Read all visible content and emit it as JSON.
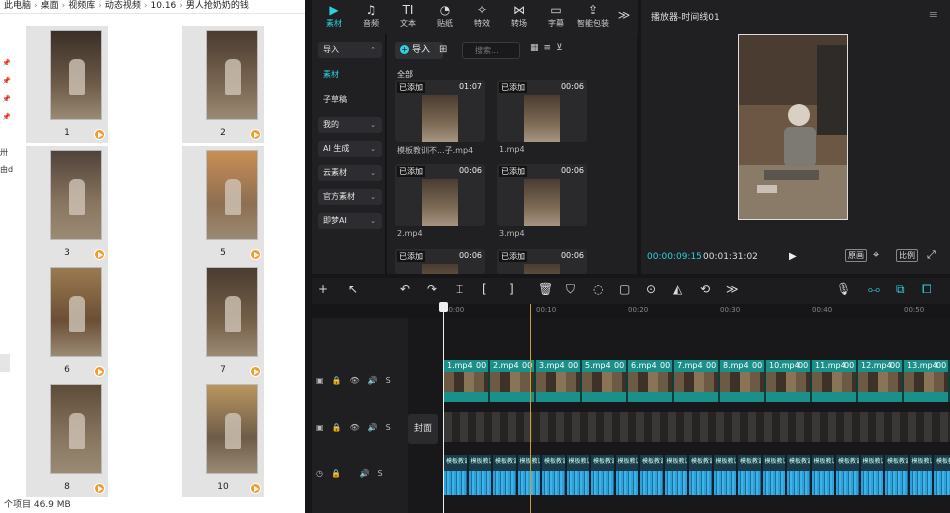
{
  "explorer": {
    "breadcrumb": [
      "此电脑",
      "桌面",
      "视频库",
      "动态视频",
      "10.16",
      "男人抢奶奶的钱"
    ],
    "nav_labels": [
      "卅",
      "由d"
    ],
    "items": [
      {
        "label": "1"
      },
      {
        "label": "2"
      },
      {
        "label": "3"
      },
      {
        "label": "5"
      },
      {
        "label": "6"
      },
      {
        "label": "7"
      },
      {
        "label": "8"
      },
      {
        "label": "10"
      }
    ],
    "status": "个项目  46.9 MB"
  },
  "top_tabs": [
    {
      "label": "素材",
      "icon": "media-icon",
      "glyph": "▶"
    },
    {
      "label": "音频",
      "icon": "audio-icon",
      "glyph": "♫"
    },
    {
      "label": "文本",
      "icon": "text-icon",
      "glyph": "TI"
    },
    {
      "label": "贴纸",
      "icon": "sticker-icon",
      "glyph": "◔"
    },
    {
      "label": "特效",
      "icon": "effects-icon",
      "glyph": "✧"
    },
    {
      "label": "转场",
      "icon": "transition-icon",
      "glyph": "⋈"
    },
    {
      "label": "字幕",
      "icon": "subtitle-icon",
      "glyph": "▭"
    },
    {
      "label": "智能包装",
      "icon": "smart-pack-icon",
      "glyph": "⇪"
    }
  ],
  "more_glyph": "≫",
  "left_menu": [
    {
      "label": "导入",
      "chev": "⌃"
    },
    {
      "label": "素材",
      "chev": ""
    },
    {
      "label": "子草稿",
      "chev": ""
    },
    {
      "label": "我的",
      "chev": "⌄"
    },
    {
      "label": "AI 生成",
      "chev": "⌄"
    },
    {
      "label": "云素材",
      "chev": "⌄"
    },
    {
      "label": "官方素材",
      "chev": "⌄"
    },
    {
      "label": "即梦AI",
      "chev": "⌄"
    }
  ],
  "media": {
    "import_label": "导入",
    "search_placeholder": "搜索...",
    "section": "全部",
    "clips": [
      {
        "badge": "已添加",
        "duration": "01:07",
        "name": "模板教训不...子.mp4"
      },
      {
        "badge": "已添加",
        "duration": "00:06",
        "name": "1.mp4"
      },
      {
        "badge": "已添加",
        "duration": "00:06",
        "name": "2.mp4"
      },
      {
        "badge": "已添加",
        "duration": "00:06",
        "name": "3.mp4"
      },
      {
        "badge": "已添加",
        "duration": "00:06",
        "name": ""
      },
      {
        "badge": "已添加",
        "duration": "00:06",
        "name": ""
      }
    ]
  },
  "player": {
    "title": "播放器-时间线01",
    "current_time": "00:00:09:15",
    "total_time": "00:01:31:02",
    "buttons": [
      "原画",
      "比例"
    ]
  },
  "timeline": {
    "ruler": [
      "00:00",
      "00:10",
      "00:20",
      "00:30",
      "00:40",
      "00:50"
    ],
    "cover_label": "封面",
    "video_clips": [
      "1.mp4",
      "2.mp4",
      "3.mp4",
      "5.mp4",
      "6.mp4",
      "7.mp4",
      "8.mp4",
      "10.mp4",
      "11.mp4",
      "12.mp4",
      "13.mp4"
    ],
    "clip_suffix": "00",
    "audio_label": "模板教训"
  }
}
